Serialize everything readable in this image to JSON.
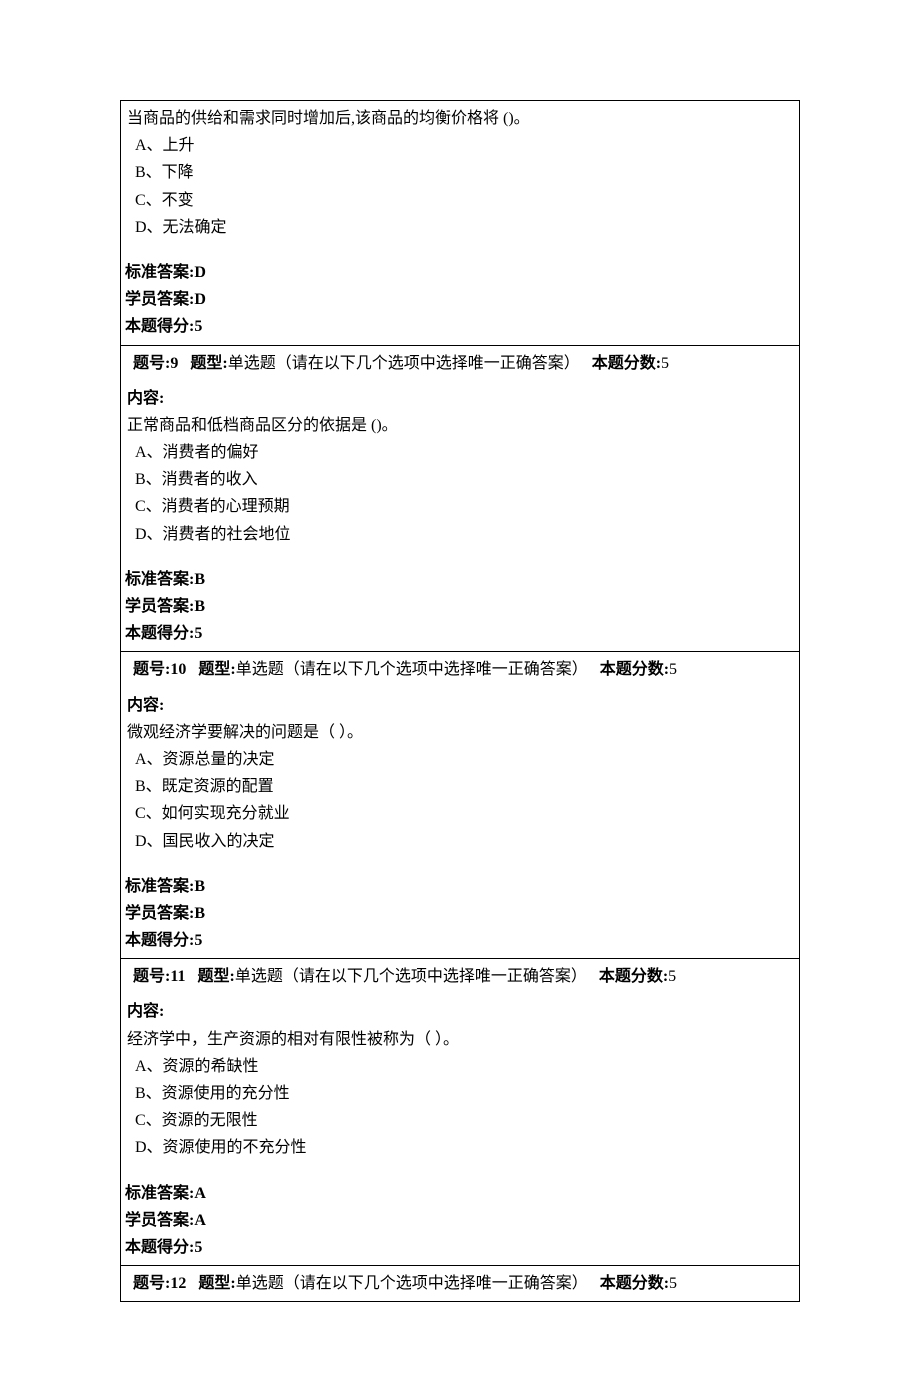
{
  "labels": {
    "question_no": "题号:",
    "type": "题型:",
    "type_value": "单选题（请在以下几个选项中选择唯一正确答案）",
    "score": "本题分数:",
    "content": "内容:",
    "std_answer": "标准答案:",
    "student_answer": "学员答案:",
    "earned": "本题得分:"
  },
  "first": {
    "stem": "当商品的供给和需求同时增加后,该商品的均衡价格将 ()。",
    "A": "A、上升",
    "B": "B、下降",
    "C": "C、不变",
    "D": "D、无法确定",
    "std_answer": "D",
    "student_answer": "D",
    "earned": "5"
  },
  "q9": {
    "no": "9",
    "score": "5",
    "stem": "正常商品和低档商品区分的依据是 ()。",
    "A": "A、消费者的偏好",
    "B": "B、消费者的收入",
    "C": "C、消费者的心理预期",
    "D": "D、消费者的社会地位",
    "std_answer": "B",
    "student_answer": "B",
    "earned": "5"
  },
  "q10": {
    "no": "10",
    "score": "5",
    "stem": "微观经济学要解决的问题是（ ）。",
    "A": "A、资源总量的决定",
    "B": "B、既定资源的配置",
    "C": "C、如何实现充分就业",
    "D": "D、国民收入的决定",
    "std_answer": "B",
    "student_answer": "B",
    "earned": "5"
  },
  "q11": {
    "no": "11",
    "score": "5",
    "stem": "经济学中，生产资源的相对有限性被称为（ ）。",
    "A": "A、资源的希缺性",
    "B": "B、资源使用的充分性",
    "C": "C、资源的无限性",
    "D": "D、资源使用的不充分性",
    "std_answer": "A",
    "student_answer": "A",
    "earned": "5"
  },
  "q12": {
    "no": "12",
    "score": "5"
  }
}
